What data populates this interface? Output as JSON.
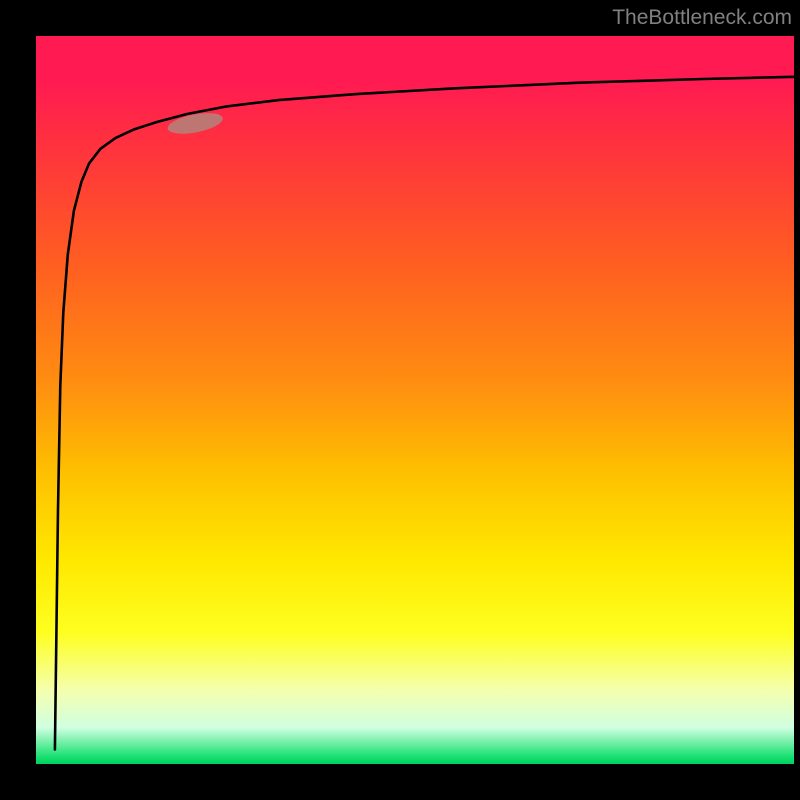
{
  "watermark": "TheBottleneck.com",
  "chart_data": {
    "type": "line",
    "title": "",
    "xlabel": "",
    "ylabel": "",
    "xlim": [
      0,
      100
    ],
    "ylim": [
      0,
      100
    ],
    "marker": {
      "x": 21,
      "y": 88,
      "color": "#b87d76"
    },
    "series": [
      {
        "name": "curve",
        "x": [
          2.5,
          2.9,
          3.2,
          3.6,
          4.2,
          5.0,
          6.0,
          7.0,
          8.5,
          10.5,
          13,
          16,
          20,
          25,
          32,
          42,
          55,
          72,
          88,
          100
        ],
        "y": [
          2,
          35,
          52,
          62,
          70,
          76,
          80,
          82.5,
          84.5,
          86,
          87.2,
          88.2,
          89.3,
          90.3,
          91.2,
          92.0,
          92.8,
          93.6,
          94.1,
          94.4
        ]
      }
    ],
    "gradient_stops": [
      {
        "pos": 0,
        "color": "#ff1a52"
      },
      {
        "pos": 50,
        "color": "#ff8f10"
      },
      {
        "pos": 80,
        "color": "#feff20"
      },
      {
        "pos": 100,
        "color": "#00d060"
      }
    ]
  }
}
